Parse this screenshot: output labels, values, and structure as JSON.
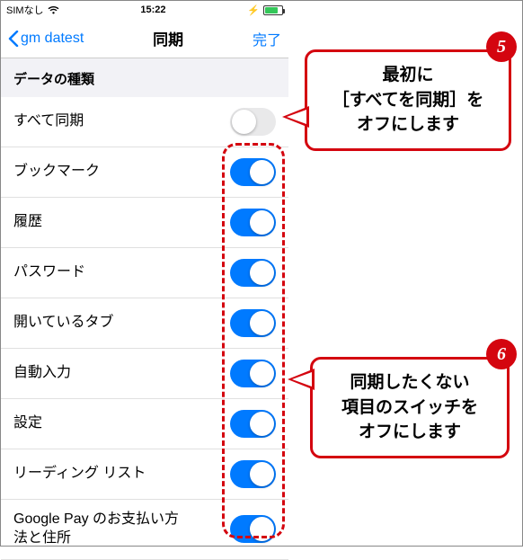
{
  "statusbar": {
    "carrier": "SIMなし",
    "time": "15:22"
  },
  "navbar": {
    "back": "gm datest",
    "title": "同期",
    "done": "完了"
  },
  "section_header": "データの種類",
  "rows": [
    {
      "label": "すべて同期",
      "on": false
    },
    {
      "label": "ブックマーク",
      "on": true
    },
    {
      "label": "履歴",
      "on": true
    },
    {
      "label": "パスワード",
      "on": true
    },
    {
      "label": "開いているタブ",
      "on": true
    },
    {
      "label": "自動入力",
      "on": true
    },
    {
      "label": "設定",
      "on": true
    },
    {
      "label": "リーディング リスト",
      "on": true
    },
    {
      "label": "Google Pay のお支払い方法と住所",
      "on": true
    }
  ],
  "callouts": [
    {
      "num": "5",
      "text": "最初に\n［すべてを同期］を\nオフにします"
    },
    {
      "num": "6",
      "text": "同期したくない\n項目のスイッチを\nオフにします"
    }
  ]
}
